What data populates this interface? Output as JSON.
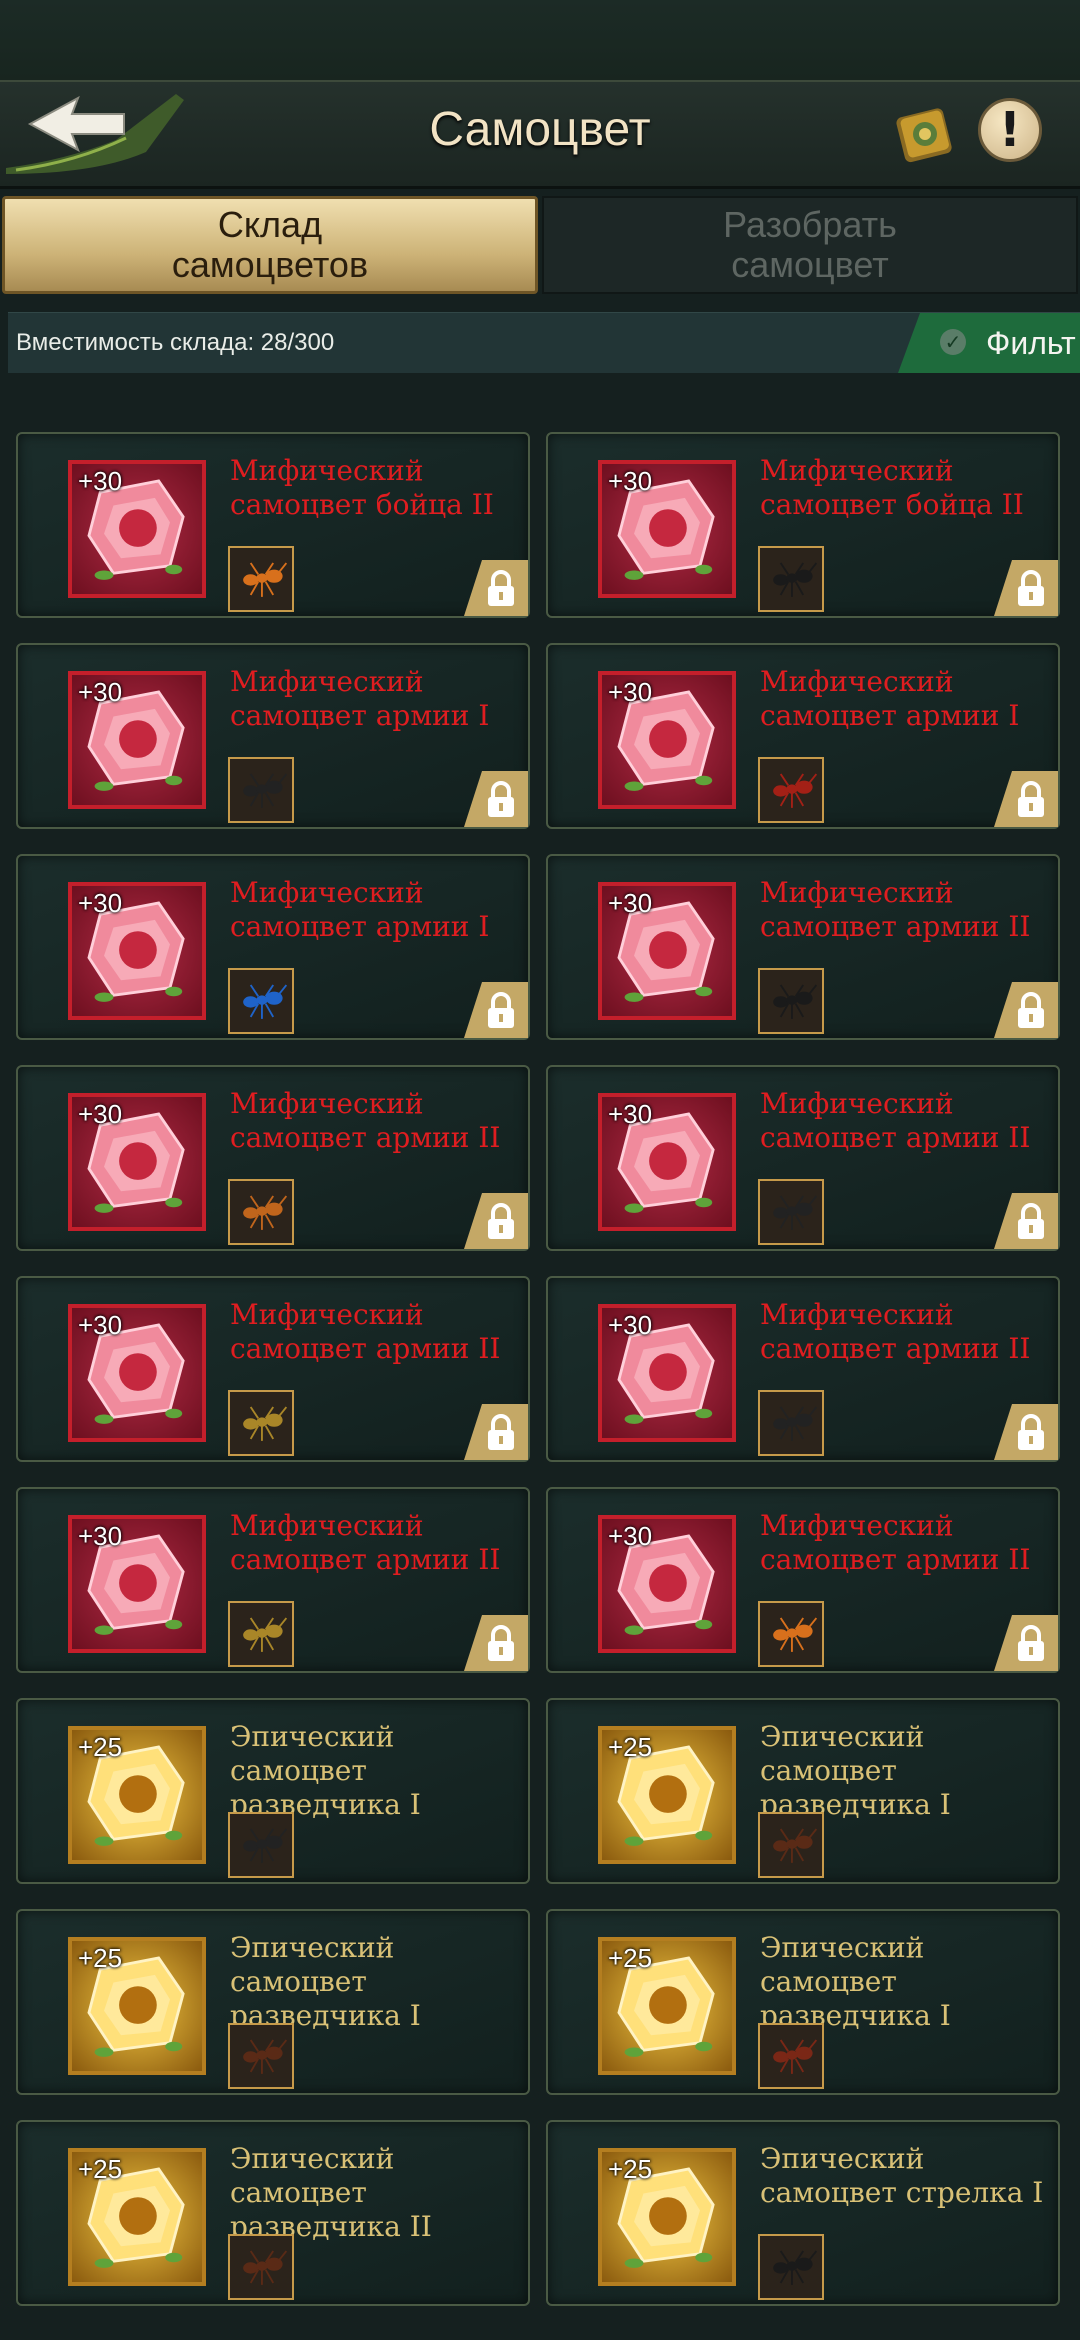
{
  "header": {
    "title": "Самоцвет",
    "back_icon": "back-arrow-icon",
    "book_icon": "book-icon",
    "info_label": "!"
  },
  "tabs": [
    {
      "label_line1": "Склад",
      "label_line2": "самоцветов",
      "active": true
    },
    {
      "label_line1": "Разобрать",
      "label_line2": "самоцвет",
      "active": false
    }
  ],
  "capacity": {
    "text": "Вместимость склада: 28/300"
  },
  "filter": {
    "label": "Фильт"
  },
  "colors": {
    "mythic": "#e01d20",
    "epic": "#d9c176",
    "accent": "#1e6b3c"
  },
  "gems": [
    {
      "level": "+30",
      "name": "Мифический самоцвет бойца II",
      "rarity": "mythic",
      "ant": "orange-ant",
      "locked": true
    },
    {
      "level": "+30",
      "name": "Мифический самоцвет бойца II",
      "rarity": "mythic",
      "ant": "black-beetle",
      "locked": true
    },
    {
      "level": "+30",
      "name": "Мифический самоцвет армии I",
      "rarity": "mythic",
      "ant": "black-ant",
      "locked": true
    },
    {
      "level": "+30",
      "name": "Мифический самоцвет армии I",
      "rarity": "mythic",
      "ant": "red-spider",
      "locked": true
    },
    {
      "level": "+30",
      "name": "Мифический самоцвет армии I",
      "rarity": "mythic",
      "ant": "blue-beetle",
      "locked": true
    },
    {
      "level": "+30",
      "name": "Мифический самоцвет армии II",
      "rarity": "mythic",
      "ant": "black-beetle",
      "locked": true
    },
    {
      "level": "+30",
      "name": "Мифический самоцвет армии II",
      "rarity": "mythic",
      "ant": "orange-beetle",
      "locked": true
    },
    {
      "level": "+30",
      "name": "Мифический самоцвет армии II",
      "rarity": "mythic",
      "ant": "black-ant",
      "locked": true
    },
    {
      "level": "+30",
      "name": "Мифический самоцвет армии II",
      "rarity": "mythic",
      "ant": "gold-beetle",
      "locked": true
    },
    {
      "level": "+30",
      "name": "Мифический самоцвет армии II",
      "rarity": "mythic",
      "ant": "black-ant",
      "locked": true
    },
    {
      "level": "+30",
      "name": "Мифический самоцвет армии II",
      "rarity": "mythic",
      "ant": "gold-beetle",
      "locked": true
    },
    {
      "level": "+30",
      "name": "Мифический самоцвет армии II",
      "rarity": "mythic",
      "ant": "orange-ant",
      "locked": true
    },
    {
      "level": "+25",
      "name": "Эпический самоцвет разведчика I",
      "rarity": "epic",
      "ant": "black-ant",
      "locked": false
    },
    {
      "level": "+25",
      "name": "Эпический самоцвет разведчика I",
      "rarity": "epic",
      "ant": "brown-ant",
      "locked": false
    },
    {
      "level": "+25",
      "name": "Эпический самоцвет разведчика I",
      "rarity": "epic",
      "ant": "brown-ant",
      "locked": false
    },
    {
      "level": "+25",
      "name": "Эпический самоцвет разведчика I",
      "rarity": "epic",
      "ant": "red-ant",
      "locked": false
    },
    {
      "level": "+25",
      "name": "Эпический самоцвет разведчика II",
      "rarity": "epic",
      "ant": "brown-ant",
      "locked": false
    },
    {
      "level": "+25",
      "name": "Эпический самоцвет стрелка I",
      "rarity": "epic",
      "ant": "black-beetle",
      "locked": false
    }
  ]
}
